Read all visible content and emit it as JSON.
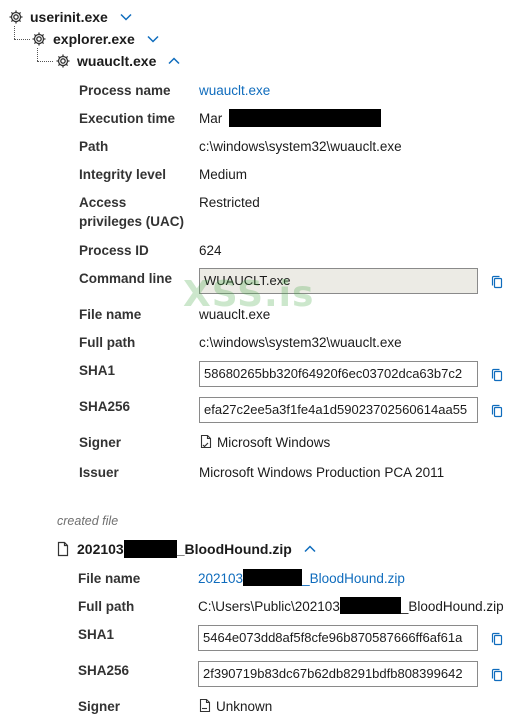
{
  "tree": {
    "nodes": [
      {
        "name": "userinit.exe",
        "chevron": "chevron-down"
      },
      {
        "name": "explorer.exe",
        "chevron": "chevron-down"
      },
      {
        "name": "wuauclt.exe",
        "chevron": "chevron-up"
      }
    ]
  },
  "process": {
    "rows": [
      {
        "label": "Process name",
        "value": "wuauclt.exe"
      },
      {
        "label": "Execution time",
        "value": "Mar"
      },
      {
        "label": "Path",
        "value": "c:\\windows\\system32\\wuauclt.exe"
      },
      {
        "label": "Integrity level",
        "value": "Medium"
      },
      {
        "label": "Access privileges (UAC)",
        "value": "Restricted"
      },
      {
        "label": "Process ID",
        "value": "624"
      },
      {
        "label": "Command line",
        "value": "WUAUCLT.exe"
      },
      {
        "label": "File name",
        "value": "wuauclt.exe"
      },
      {
        "label": "Full path",
        "value": "c:\\windows\\system32\\wuauclt.exe"
      },
      {
        "label": "SHA1",
        "value": "58680265bb320f64920f6ec03702dca63b7c2"
      },
      {
        "label": "SHA256",
        "value": "efa27c2ee5a3f1fe4a1d59023702560614aa55"
      },
      {
        "label": "Signer",
        "value": "Microsoft Windows"
      },
      {
        "label": "Issuer",
        "value": "Microsoft Windows Production PCA 2011"
      }
    ],
    "access_label_line1": "Access",
    "access_label_line2": "privileges (UAC)"
  },
  "created": {
    "section_label": "created file",
    "file_prefix": "202103",
    "file_suffix": "_BloodHound.zip",
    "chevron": "chevron-up",
    "rows": [
      {
        "label": "File name",
        "prefix": "202103",
        "suffix": "_BloodHound.zip"
      },
      {
        "label": "Full path",
        "prefix": "C:\\Users\\Public\\202103",
        "suffix": "_BloodHound.zip"
      },
      {
        "label": "SHA1",
        "value": "5464e073dd8af5f8cfe96b870587666ff6af61a"
      },
      {
        "label": "SHA256",
        "value": "2f390719b83dc67b62db8291bdfb808399642"
      },
      {
        "label": "Signer",
        "value": "Unknown"
      }
    ]
  },
  "watermark": "XSS.is",
  "colors": {
    "link": "#0f6cbd",
    "redaction": "#000000",
    "readonly_field_bg": "#ecebe5"
  }
}
